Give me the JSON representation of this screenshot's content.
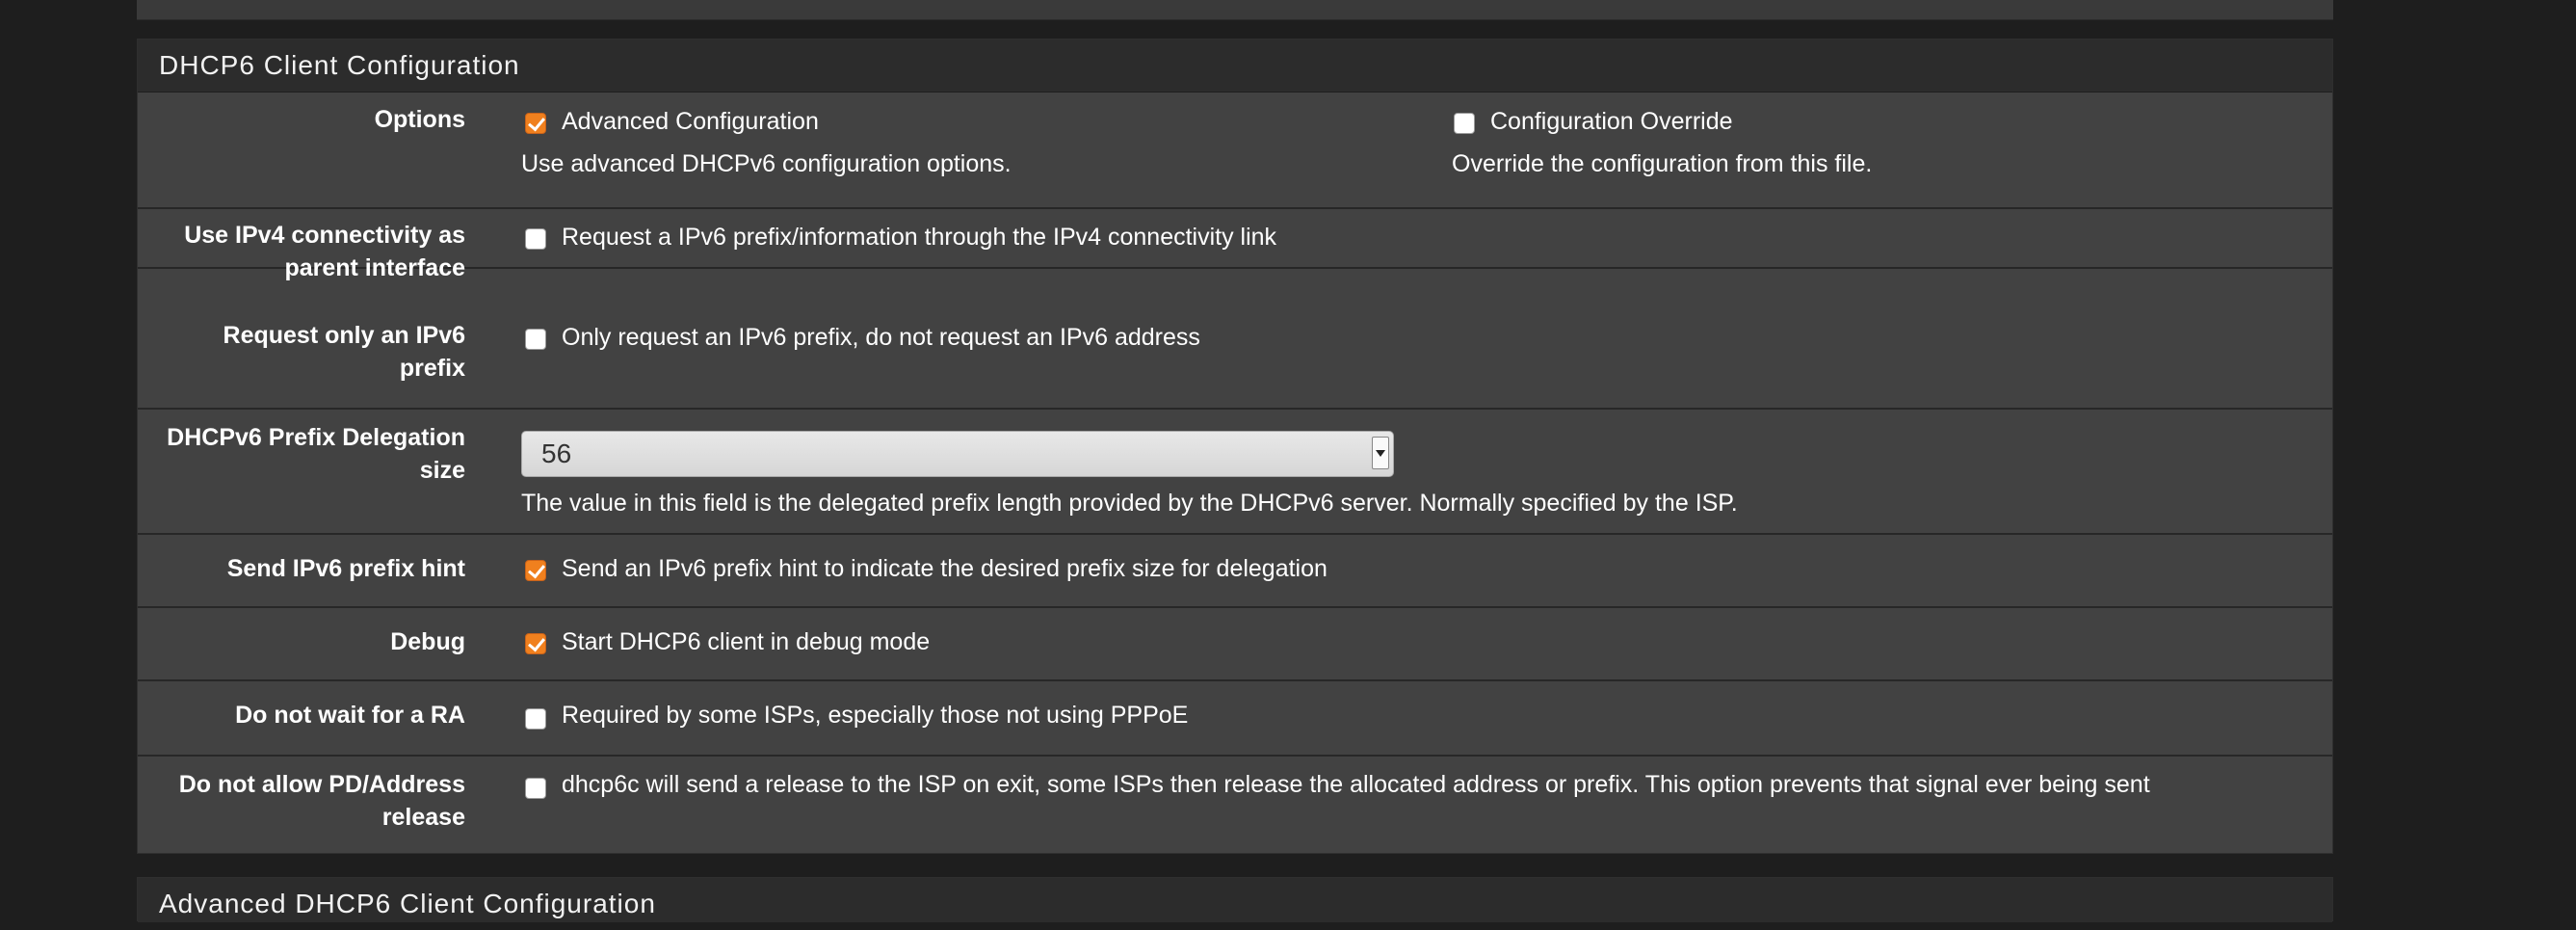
{
  "section": {
    "title": "DHCP6 Client Configuration"
  },
  "rows": [
    {
      "label": "Options",
      "options": [
        {
          "label": "Advanced Configuration",
          "checked": true,
          "help": "Use advanced DHCPv6 configuration options."
        },
        {
          "label": "Configuration Override",
          "checked": false,
          "help": "Override the configuration from this file."
        }
      ]
    },
    {
      "label_line1": "Use IPv4 connectivity as",
      "label_line2": "parent interface",
      "checkbox_label": "Request a IPv6 prefix/information through the IPv4 connectivity link",
      "checked": false
    },
    {
      "label_line1": "Request only an IPv6",
      "label_line2": "prefix",
      "checkbox_label": "Only request an IPv6 prefix, do not request an IPv6 address",
      "checked": false
    },
    {
      "label_line1": "DHCPv6 Prefix Delegation",
      "label_line2": "size",
      "select_value": "56",
      "help": "The value in this field is the delegated prefix length provided by the DHCPv6 server. Normally specified by the ISP."
    },
    {
      "label": "Send IPv6 prefix hint",
      "checkbox_label": "Send an IPv6 prefix hint to indicate the desired prefix size for delegation",
      "checked": true
    },
    {
      "label": "Debug",
      "checkbox_label": "Start DHCP6 client in debug mode",
      "checked": true
    },
    {
      "label": "Do not wait for a RA",
      "checkbox_label": "Required by some ISPs, especially those not using PPPoE",
      "checked": false
    },
    {
      "label_line1": "Do not allow PD/Address",
      "label_line2": "release",
      "checkbox_label": "dhcp6c will send a release to the ISP on exit, some ISPs then release the allocated address or prefix. This option prevents that signal ever being sent",
      "checked": false
    }
  ],
  "next_section": {
    "title": "Advanced DHCP6 Client Configuration"
  },
  "colors": {
    "accent_checkbox": "#f0801e",
    "panel": "#424242",
    "heading": "#2c2c2c",
    "background": "#1e1e1e"
  }
}
